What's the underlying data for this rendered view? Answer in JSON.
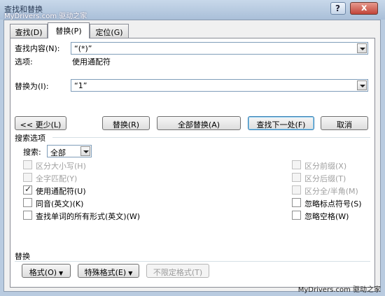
{
  "window": {
    "title": "查找和替换",
    "watermark_top": "MyDrivers.com 驱动之家",
    "help_label": "?",
    "close_label": "x"
  },
  "tabs": [
    {
      "label": "查找(D)"
    },
    {
      "label": "替换(P)"
    },
    {
      "label": "定位(G)"
    }
  ],
  "find": {
    "label": "查找内容(N):",
    "value": "“(*)”",
    "options_label": "选项:",
    "options_value": "使用通配符"
  },
  "replace": {
    "label": "替换为(I):",
    "value": "“1”"
  },
  "buttons": {
    "less": "<< 更少(L)",
    "replace": "替换(R)",
    "replace_all": "全部替换(A)",
    "find_next": "查找下一处(F)",
    "cancel": "取消"
  },
  "search_options": {
    "heading": "搜索选项",
    "search_label": "搜索:",
    "search_value": "全部",
    "left": [
      {
        "label": "区分大小写(H)",
        "checked": false,
        "disabled": true
      },
      {
        "label": "全字匹配(Y)",
        "checked": false,
        "disabled": true
      },
      {
        "label": "使用通配符(U)",
        "checked": true,
        "disabled": false
      },
      {
        "label": "同音(英文)(K)",
        "checked": false,
        "disabled": false
      },
      {
        "label": "查找单词的所有形式(英文)(W)",
        "checked": false,
        "disabled": false
      }
    ],
    "right": [
      {
        "label": "区分前缀(X)",
        "checked": false,
        "disabled": true
      },
      {
        "label": "区分后缀(T)",
        "checked": false,
        "disabled": true
      },
      {
        "label": "区分全/半角(M)",
        "checked": false,
        "disabled": true
      },
      {
        "label": "忽略标点符号(S)",
        "checked": false,
        "disabled": false
      },
      {
        "label": "忽略空格(W)",
        "checked": false,
        "disabled": false
      }
    ]
  },
  "replace_section": {
    "heading": "替换",
    "format": "格式(O)",
    "special": "特殊格式(E)",
    "no_format": "不限定格式(T)"
  },
  "watermark_bottom": "MyDrivers.com 驱动之家"
}
